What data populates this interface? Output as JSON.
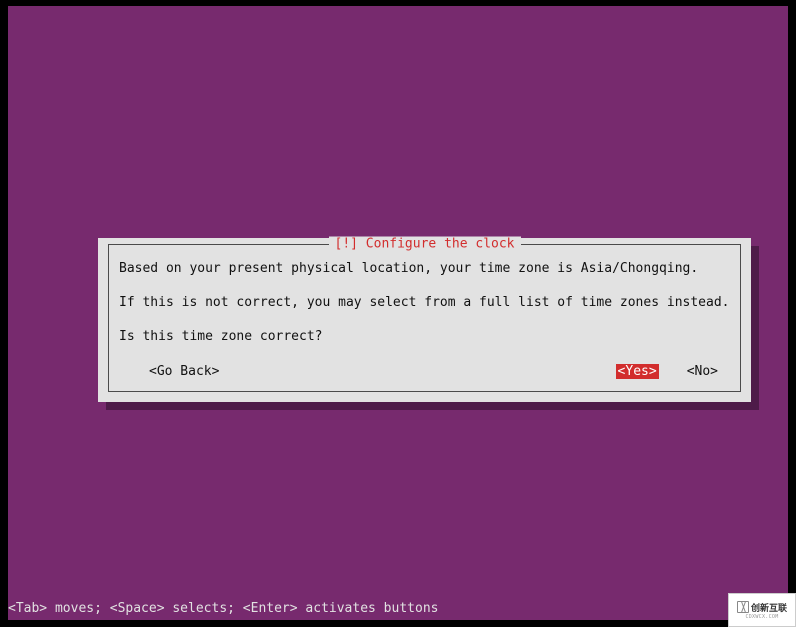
{
  "dialog": {
    "title": "[!] Configure the clock",
    "line1": "Based on your present physical location, your time zone is Asia/Chongqing.",
    "line2": "If this is not correct, you may select from a full list of time zones instead.",
    "line3": "Is this time zone correct?",
    "go_back": "<Go Back>",
    "yes": "<Yes>",
    "no": "<No>"
  },
  "footer": {
    "hint": "<Tab> moves; <Space> selects; <Enter> activates buttons"
  },
  "watermark": {
    "brand": "创新互联",
    "sub": "CDXWCX.COM"
  },
  "colors": {
    "background": "#772A6E",
    "dialog_bg": "#E2E2E2",
    "accent": "#D22D2D"
  }
}
